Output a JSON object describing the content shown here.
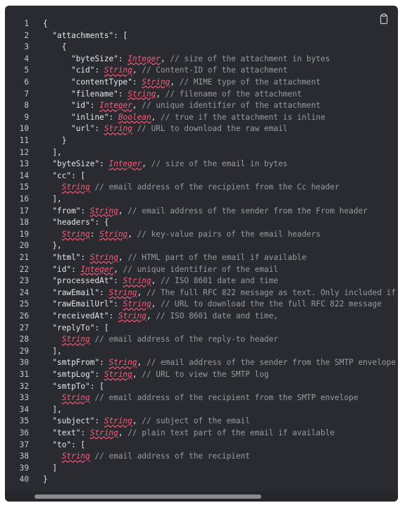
{
  "copy": {
    "icon": "clipboard-icon"
  },
  "code": {
    "lines": [
      {
        "n": "1",
        "parts": [
          {
            "t": "{",
            "s": "k"
          }
        ]
      },
      {
        "n": "2",
        "parts": [
          {
            "t": "  \"attachments\": [",
            "s": "k"
          }
        ]
      },
      {
        "n": "3",
        "parts": [
          {
            "t": "    {",
            "s": "k"
          }
        ]
      },
      {
        "n": "4",
        "parts": [
          {
            "t": "      \"byteSize\": ",
            "s": "k"
          },
          {
            "t": "Integer",
            "s": "t"
          },
          {
            "t": ", ",
            "s": "k"
          },
          {
            "t": "// size of the attachment in bytes",
            "s": "c"
          }
        ]
      },
      {
        "n": "5",
        "parts": [
          {
            "t": "      \"cid\": ",
            "s": "k"
          },
          {
            "t": "String",
            "s": "t"
          },
          {
            "t": ", ",
            "s": "k"
          },
          {
            "t": "// Content-ID of the attachment",
            "s": "c"
          }
        ]
      },
      {
        "n": "6",
        "parts": [
          {
            "t": "      \"contentType\": ",
            "s": "k"
          },
          {
            "t": "String",
            "s": "t"
          },
          {
            "t": ", ",
            "s": "k"
          },
          {
            "t": "// MIME type of the attachment",
            "s": "c"
          }
        ]
      },
      {
        "n": "7",
        "parts": [
          {
            "t": "      \"filename\": ",
            "s": "k"
          },
          {
            "t": "String",
            "s": "t"
          },
          {
            "t": ", ",
            "s": "k"
          },
          {
            "t": "// filename of the attachment",
            "s": "c"
          }
        ]
      },
      {
        "n": "8",
        "parts": [
          {
            "t": "      \"id\": ",
            "s": "k"
          },
          {
            "t": "Integer",
            "s": "t"
          },
          {
            "t": ", ",
            "s": "k"
          },
          {
            "t": "// unique identifier of the attachment",
            "s": "c"
          }
        ]
      },
      {
        "n": "9",
        "parts": [
          {
            "t": "      \"inline\": ",
            "s": "k"
          },
          {
            "t": "Boolean",
            "s": "t"
          },
          {
            "t": ", ",
            "s": "k"
          },
          {
            "t": "// true if the attachment is inline",
            "s": "c"
          }
        ]
      },
      {
        "n": "10",
        "parts": [
          {
            "t": "      \"url\": ",
            "s": "k"
          },
          {
            "t": "String",
            "s": "t"
          },
          {
            "t": " ",
            "s": "k"
          },
          {
            "t": "// URL to download the raw email",
            "s": "c"
          }
        ]
      },
      {
        "n": "11",
        "parts": [
          {
            "t": "    }",
            "s": "k"
          }
        ]
      },
      {
        "n": "12",
        "parts": [
          {
            "t": "  ],",
            "s": "k"
          }
        ]
      },
      {
        "n": "13",
        "parts": [
          {
            "t": "  \"byteSize\": ",
            "s": "k"
          },
          {
            "t": "Integer",
            "s": "t"
          },
          {
            "t": ", ",
            "s": "k"
          },
          {
            "t": "// size of the email in bytes",
            "s": "c"
          }
        ]
      },
      {
        "n": "14",
        "parts": [
          {
            "t": "  \"cc\": [",
            "s": "k"
          }
        ]
      },
      {
        "n": "15",
        "parts": [
          {
            "t": "    ",
            "s": "k"
          },
          {
            "t": "String",
            "s": "t"
          },
          {
            "t": " ",
            "s": "k"
          },
          {
            "t": "// email address of the recipient from the Cc header",
            "s": "c"
          }
        ]
      },
      {
        "n": "16",
        "parts": [
          {
            "t": "  ],",
            "s": "k"
          }
        ]
      },
      {
        "n": "17",
        "parts": [
          {
            "t": "  \"from\": ",
            "s": "k"
          },
          {
            "t": "String",
            "s": "t"
          },
          {
            "t": ", ",
            "s": "k"
          },
          {
            "t": "// email address of the sender from the From header",
            "s": "c"
          }
        ]
      },
      {
        "n": "18",
        "parts": [
          {
            "t": "  \"headers\": {",
            "s": "k"
          }
        ]
      },
      {
        "n": "19",
        "parts": [
          {
            "t": "    ",
            "s": "k"
          },
          {
            "t": "String",
            "s": "t"
          },
          {
            "t": ": ",
            "s": "k"
          },
          {
            "t": "String",
            "s": "t"
          },
          {
            "t": ", ",
            "s": "k"
          },
          {
            "t": "// key-value pairs of the email headers",
            "s": "c"
          }
        ]
      },
      {
        "n": "20",
        "parts": [
          {
            "t": "  },",
            "s": "k"
          }
        ]
      },
      {
        "n": "21",
        "parts": [
          {
            "t": "  \"html\": ",
            "s": "k"
          },
          {
            "t": "String",
            "s": "t"
          },
          {
            "t": ", ",
            "s": "k"
          },
          {
            "t": "// HTML part of the email if available",
            "s": "c"
          }
        ]
      },
      {
        "n": "22",
        "parts": [
          {
            "t": "  \"id\": ",
            "s": "k"
          },
          {
            "t": "Integer",
            "s": "t"
          },
          {
            "t": ", ",
            "s": "k"
          },
          {
            "t": "// unique identifier of the email",
            "s": "c"
          }
        ]
      },
      {
        "n": "23",
        "parts": [
          {
            "t": "  \"processedAt\": ",
            "s": "k"
          },
          {
            "t": "String",
            "s": "t"
          },
          {
            "t": ", ",
            "s": "k"
          },
          {
            "t": "// ISO 8601 date and time",
            "s": "c"
          }
        ]
      },
      {
        "n": "24",
        "parts": [
          {
            "t": "  \"rawEmail\": ",
            "s": "k"
          },
          {
            "t": "String",
            "s": "t"
          },
          {
            "t": ", ",
            "s": "k"
          },
          {
            "t": "// The full RFC 822 message as text. Only included if the ma",
            "s": "c"
          }
        ]
      },
      {
        "n": "25",
        "parts": [
          {
            "t": "  \"rawEmailUrl\": ",
            "s": "k"
          },
          {
            "t": "String",
            "s": "t"
          },
          {
            "t": ", ",
            "s": "k"
          },
          {
            "t": "// URL to download the the full RFC 822 message",
            "s": "c"
          }
        ]
      },
      {
        "n": "26",
        "parts": [
          {
            "t": "  \"receivedAt\": ",
            "s": "k"
          },
          {
            "t": "String",
            "s": "t"
          },
          {
            "t": ", ",
            "s": "k"
          },
          {
            "t": "// ISO 8601 date and time,",
            "s": "c"
          }
        ]
      },
      {
        "n": "27",
        "parts": [
          {
            "t": "  \"replyTo\": [",
            "s": "k"
          }
        ]
      },
      {
        "n": "28",
        "parts": [
          {
            "t": "    ",
            "s": "k"
          },
          {
            "t": "String",
            "s": "t"
          },
          {
            "t": " ",
            "s": "k"
          },
          {
            "t": "// email address of the reply-to header",
            "s": "c"
          }
        ]
      },
      {
        "n": "29",
        "parts": [
          {
            "t": "  ],",
            "s": "k"
          }
        ]
      },
      {
        "n": "30",
        "parts": [
          {
            "t": "  \"smtpFrom\": ",
            "s": "k"
          },
          {
            "t": "String",
            "s": "t"
          },
          {
            "t": ", ",
            "s": "k"
          },
          {
            "t": "// email address of the sender from the SMTP envelope",
            "s": "c"
          }
        ]
      },
      {
        "n": "31",
        "parts": [
          {
            "t": "  \"smtpLog\": ",
            "s": "k"
          },
          {
            "t": "String",
            "s": "t"
          },
          {
            "t": ", ",
            "s": "k"
          },
          {
            "t": "// URL to view the SMTP log",
            "s": "c"
          }
        ]
      },
      {
        "n": "32",
        "parts": [
          {
            "t": "  \"smtpTo\": [",
            "s": "k"
          }
        ]
      },
      {
        "n": "33",
        "parts": [
          {
            "t": "    ",
            "s": "k"
          },
          {
            "t": "String",
            "s": "t"
          },
          {
            "t": " ",
            "s": "k"
          },
          {
            "t": "// email address of the recipient from the SMTP envelope",
            "s": "c"
          }
        ]
      },
      {
        "n": "34",
        "parts": [
          {
            "t": "  ],",
            "s": "k"
          }
        ]
      },
      {
        "n": "35",
        "parts": [
          {
            "t": "  \"subject\": ",
            "s": "k"
          },
          {
            "t": "String",
            "s": "t"
          },
          {
            "t": ", ",
            "s": "k"
          },
          {
            "t": "// subject of the email",
            "s": "c"
          }
        ]
      },
      {
        "n": "36",
        "parts": [
          {
            "t": "  \"text\": ",
            "s": "k"
          },
          {
            "t": "String",
            "s": "t"
          },
          {
            "t": ", ",
            "s": "k"
          },
          {
            "t": "// plain text part of the email if available",
            "s": "c"
          }
        ]
      },
      {
        "n": "37",
        "parts": [
          {
            "t": "  \"to\": [",
            "s": "k"
          }
        ]
      },
      {
        "n": "38",
        "parts": [
          {
            "t": "    ",
            "s": "k"
          },
          {
            "t": "String",
            "s": "t"
          },
          {
            "t": " ",
            "s": "k"
          },
          {
            "t": "// email address of the recipient",
            "s": "c"
          }
        ]
      },
      {
        "n": "39",
        "parts": [
          {
            "t": "  ]",
            "s": "k"
          }
        ]
      },
      {
        "n": "40",
        "parts": [
          {
            "t": "}",
            "s": "k"
          }
        ]
      }
    ]
  },
  "colors": {
    "background": "#2a2b30",
    "type": "#ff5a7a",
    "comment": "#9a9a9a",
    "text": "#e7e7e7"
  }
}
